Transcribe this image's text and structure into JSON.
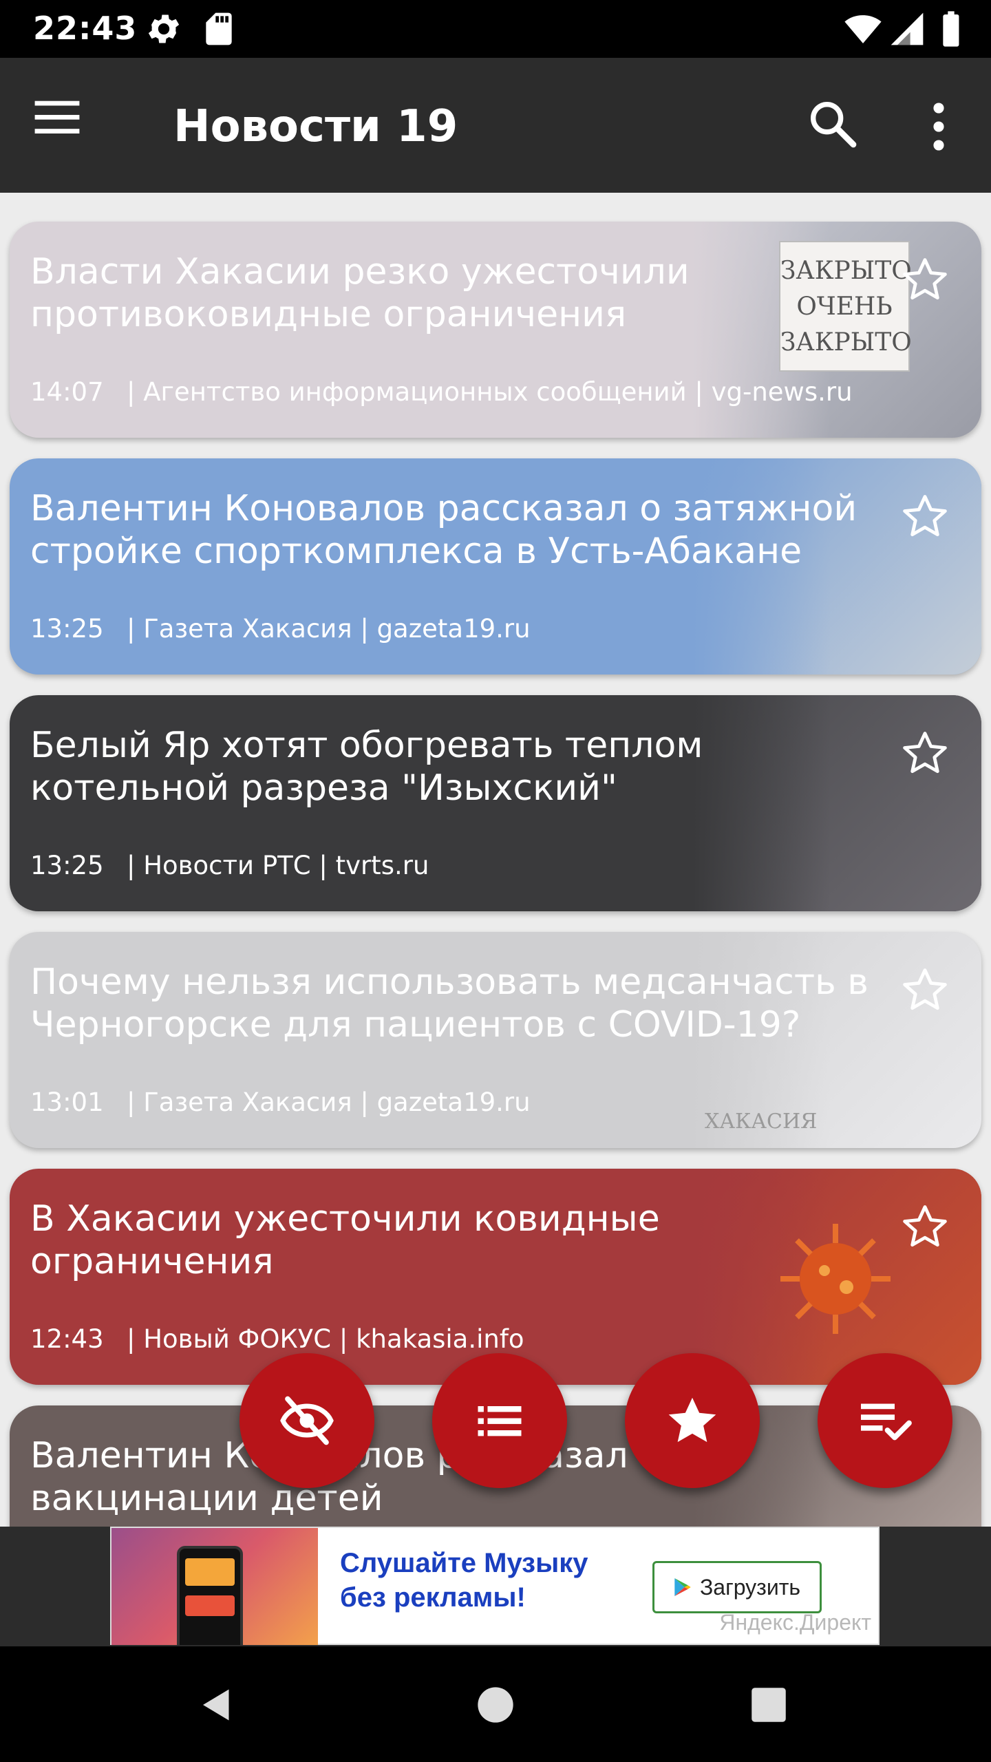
{
  "status_bar": {
    "time": "22:43",
    "icons": [
      "gear-icon",
      "sd-card-icon",
      "wifi-icon",
      "signal-icon",
      "battery-icon"
    ]
  },
  "toolbar": {
    "title": "Новости 19",
    "icons": [
      "menu-icon",
      "search-icon",
      "more-vert-icon"
    ]
  },
  "feed": {
    "items": [
      {
        "headline": "Власти Хакасии резко ужесточили противоковидные ограничения",
        "time": "14:07",
        "source": "| Агентство информационных сообщений | vg-news.ru",
        "background": "#d9d2d8",
        "text_color": "#ffffff",
        "thumb": [
          "#c7c9d2",
          "#9a9ca6"
        ],
        "thumb_sign": [
          "ЗАКРЫТО",
          "ОЧЕНЬ",
          "ЗАКРЫТО"
        ]
      },
      {
        "headline": "Валентин Коновалов рассказал о затяжной стройке спорткомплекса в Усть-Абакане",
        "time": "13:25",
        "source": "| Газета Хакасия | gazeta19.ru",
        "background": "#7ea3d6",
        "text_color": "#ffffff",
        "thumb": [
          "#7ea3d6",
          "#c4cdd7"
        ]
      },
      {
        "headline": "Белый Яр хотят обогревать теплом котельной разреза \"Изыхский\"",
        "time": "13:25",
        "source": "| Новости РТС | tvrts.ru",
        "background": "#3a3a3c",
        "text_color": "#ffffff",
        "thumb": [
          "#4a4a4e",
          "#6d6a70"
        ]
      },
      {
        "headline": "Почему нельзя использовать медсанчасть в Черногорске для пациентов с COVID-19?",
        "time": "13:01",
        "source": "| Газета Хакасия | gazeta19.ru",
        "background": "#cfcfd1",
        "text_color": "#ffffff",
        "thumb": [
          "#d4d4d6",
          "#eaeaec"
        ],
        "thumb_caption": "ХАКАСИЯ"
      },
      {
        "headline": "В Хакасии ужесточили ковидные ограничения",
        "time": "12:43",
        "source": "| Новый ФОКУС | khakasia.info",
        "background": "#a53a3c",
        "text_color": "#ffffff",
        "thumb": [
          "#a53a3c",
          "#c8512f"
        ]
      },
      {
        "headline": "Валентин Коновалов рассказал о вакцинации детей",
        "time": "",
        "source": "",
        "background": "#6b5e5c",
        "text_color": "#ffffff",
        "thumb": [
          "#6b5e5c",
          "#b9aba6"
        ]
      }
    ]
  },
  "fabs": [
    {
      "name": "hide-read-fab",
      "icon": "eye-off-icon"
    },
    {
      "name": "list-view-fab",
      "icon": "list-icon"
    },
    {
      "name": "favorites-fab",
      "icon": "star-icon"
    },
    {
      "name": "mark-read-fab",
      "icon": "playlist-check-icon"
    }
  ],
  "ad": {
    "text_line1": "Слушайте Музыку",
    "text_line2": "без рекламы!",
    "cta": "Загрузить",
    "source": "Яндекс.Директ",
    "icon": "google-play-icon"
  },
  "nav_bar": {
    "icons": [
      "back-icon",
      "home-icon",
      "recents-icon"
    ]
  },
  "colors": {
    "toolbar": "#2c2c2c",
    "fab": "#b71419",
    "feed_background": "#ececec"
  }
}
